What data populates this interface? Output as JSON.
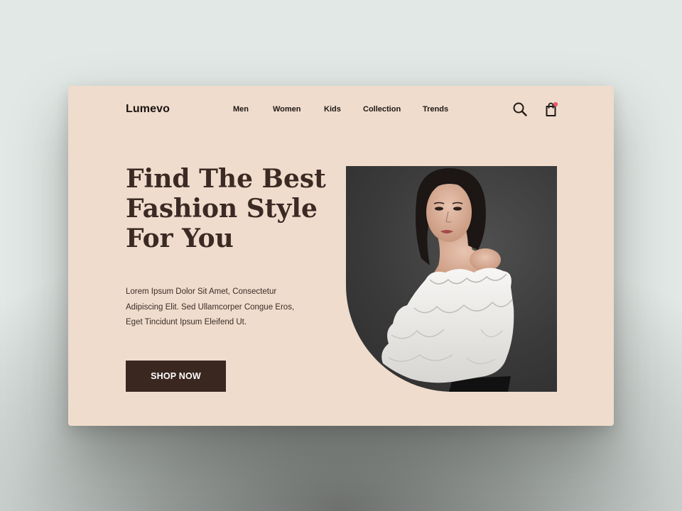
{
  "brand": {
    "name": "Lumevo"
  },
  "nav": {
    "items": [
      {
        "label": "Men"
      },
      {
        "label": "Women"
      },
      {
        "label": "Kids"
      },
      {
        "label": "Collection"
      },
      {
        "label": "Trends"
      }
    ]
  },
  "header_icons": {
    "search": "search-icon",
    "cart": "shopping-bag-icon",
    "cart_badge_color": "#e45a6a"
  },
  "hero": {
    "headline_lines": [
      "Find The Best",
      "Fashion Style",
      "For You"
    ],
    "description_lines": [
      "Lorem Ipsum Dolor Sit Amet, Consectetur",
      "Adipiscing Elit. Sed Ullamcorper Congue Eros,",
      "Eget Tincidunt Ipsum Eleifend Ut."
    ],
    "cta_label": "SHOP NOW",
    "image_subject": "woman in white off-shoulder ruffled blouse"
  },
  "colors": {
    "card_background": "#efdccc",
    "headline": "#3b2a24",
    "button_background": "#3a2820",
    "button_text": "#ffffff"
  }
}
